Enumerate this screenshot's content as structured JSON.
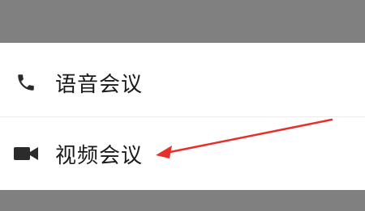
{
  "menu": {
    "items": [
      {
        "label": "语音会议",
        "icon": "phone-icon"
      },
      {
        "label": "视频会议",
        "icon": "video-camera-icon"
      }
    ]
  },
  "colors": {
    "overlay": "#808080",
    "sheet": "#ffffff",
    "text": "#1a1a1a",
    "icon": "#2b2b2b",
    "annotation": "#e8302a"
  },
  "annotation": {
    "type": "arrow",
    "color": "#e8302a",
    "points_to": "视频会议"
  }
}
